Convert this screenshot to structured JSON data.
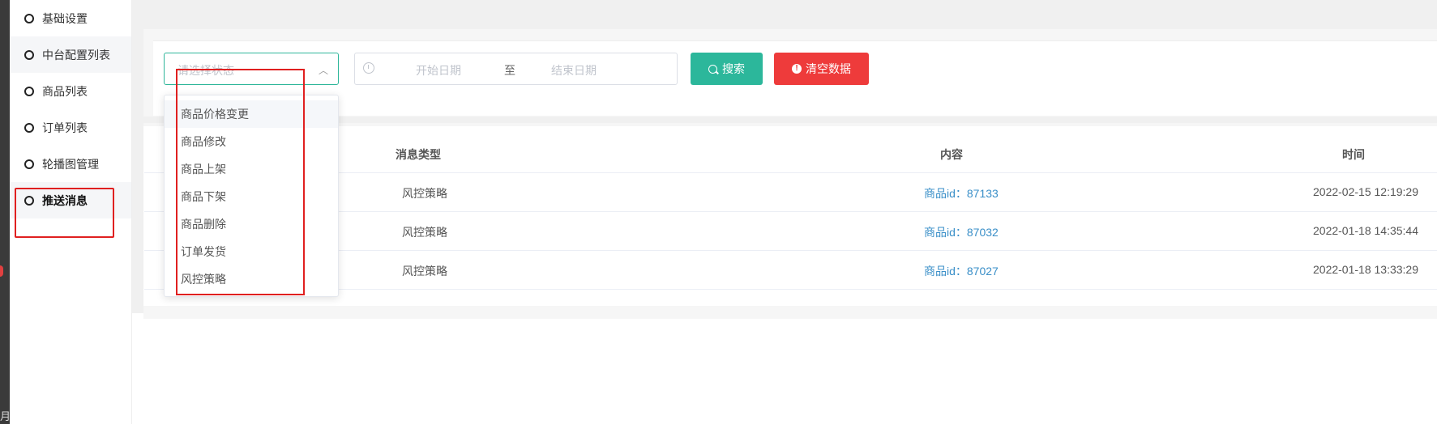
{
  "left_strip_glyph": "月",
  "sidebar": {
    "items": [
      {
        "label": "基础设置"
      },
      {
        "label": "中台配置列表"
      },
      {
        "label": "商品列表"
      },
      {
        "label": "订单列表"
      },
      {
        "label": "轮播图管理"
      },
      {
        "label": "推送消息"
      }
    ],
    "active_index": 5
  },
  "filters": {
    "status_placeholder": "请选择状态",
    "date_start_placeholder": "开始日期",
    "date_separator": "至",
    "date_end_placeholder": "结束日期",
    "search_label": "搜索",
    "clear_label": "清空数据"
  },
  "dropdown": {
    "options": [
      "商品价格变更",
      "商品修改",
      "商品上架",
      "商品下架",
      "商品删除",
      "订单发货",
      "风控策略"
    ],
    "hovered_index": 0
  },
  "table": {
    "headers": {
      "type": "消息类型",
      "content": "内容",
      "time": "时间"
    },
    "rows": [
      {
        "type": "风控策略",
        "content": "商品id：87133",
        "time": "2022-02-15 12:19:29"
      },
      {
        "type": "风控策略",
        "content": "商品id：87032",
        "time": "2022-01-18 14:35:44"
      },
      {
        "type": "风控策略",
        "content": "商品id：87027",
        "time": "2022-01-18 13:33:29"
      }
    ]
  },
  "colors": {
    "accent": "#2cb79b",
    "danger": "#ee3b3b",
    "link": "#3a8fc8",
    "annotation": "#e02020"
  }
}
